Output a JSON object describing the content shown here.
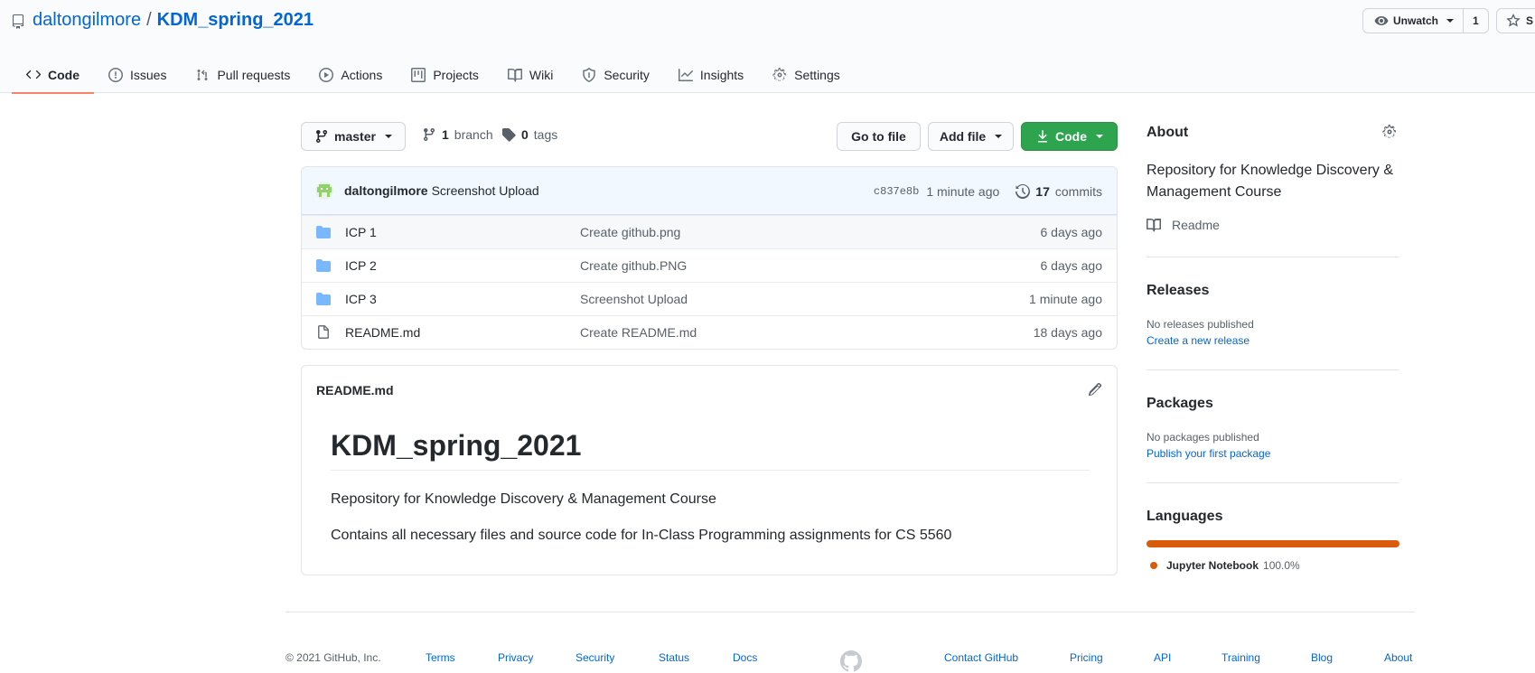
{
  "repo": {
    "owner": "daltongilmore",
    "separator": "/",
    "name": "KDM_spring_2021",
    "watch_label": "Unwatch",
    "watch_count": "1",
    "star_label": "S"
  },
  "tabs": [
    {
      "label": "Code",
      "icon": "code-icon"
    },
    {
      "label": "Issues",
      "icon": "issue-icon"
    },
    {
      "label": "Pull requests",
      "icon": "pull-request-icon"
    },
    {
      "label": "Actions",
      "icon": "play-icon"
    },
    {
      "label": "Projects",
      "icon": "project-icon"
    },
    {
      "label": "Wiki",
      "icon": "book-icon"
    },
    {
      "label": "Security",
      "icon": "shield-icon"
    },
    {
      "label": "Insights",
      "icon": "graph-icon"
    },
    {
      "label": "Settings",
      "icon": "gear-icon"
    }
  ],
  "toolbar": {
    "branch": "master",
    "branch_count": "1",
    "branch_label": "branch",
    "tag_count": "0",
    "tag_label": "tags",
    "go_to_file": "Go to file",
    "add_file": "Add file",
    "code": "Code"
  },
  "last_commit": {
    "author": "daltongilmore",
    "message": "Screenshot Upload",
    "sha": "c837e8b",
    "age": "1 minute ago",
    "commit_count": "17",
    "commit_label": "commits"
  },
  "files": [
    {
      "name": "ICP 1",
      "type": "folder",
      "message": "Create github.png",
      "age": "6 days ago"
    },
    {
      "name": "ICP 2",
      "type": "folder",
      "message": "Create github.PNG",
      "age": "6 days ago"
    },
    {
      "name": "ICP 3",
      "type": "folder",
      "message": "Screenshot Upload",
      "age": "1 minute ago"
    },
    {
      "name": "README.md",
      "type": "file",
      "message": "Create README.md",
      "age": "18 days ago"
    }
  ],
  "readme": {
    "filename": "README.md",
    "heading": "KDM_spring_2021",
    "paragraph1": "Repository for Knowledge Discovery & Management Course",
    "paragraph2": "Contains all necessary files and source code for In-Class Programming assignments for CS 5560"
  },
  "sidebar": {
    "about_title": "About",
    "about_description": "Repository for Knowledge Discovery & Management Course",
    "readme_link": "Readme",
    "releases_title": "Releases",
    "releases_text": "No releases published",
    "releases_link": "Create a new release",
    "packages_title": "Packages",
    "packages_text": "No packages published",
    "packages_link": "Publish your first package",
    "languages_title": "Languages",
    "language_name": "Jupyter Notebook",
    "language_percent": "100.0%",
    "language_color": "#DA5B0B"
  },
  "footer": {
    "copyright": "© 2021 GitHub, Inc.",
    "left_links": [
      "Terms",
      "Privacy",
      "Security",
      "Status",
      "Docs"
    ],
    "right_links": [
      "Contact GitHub",
      "Pricing",
      "API",
      "Training",
      "Blog",
      "About"
    ]
  },
  "colors": {
    "accent_link": "#0366d6",
    "primary_button": "#2ea44f",
    "tab_underline": "#f9826c",
    "folder": "#79b8ff"
  }
}
